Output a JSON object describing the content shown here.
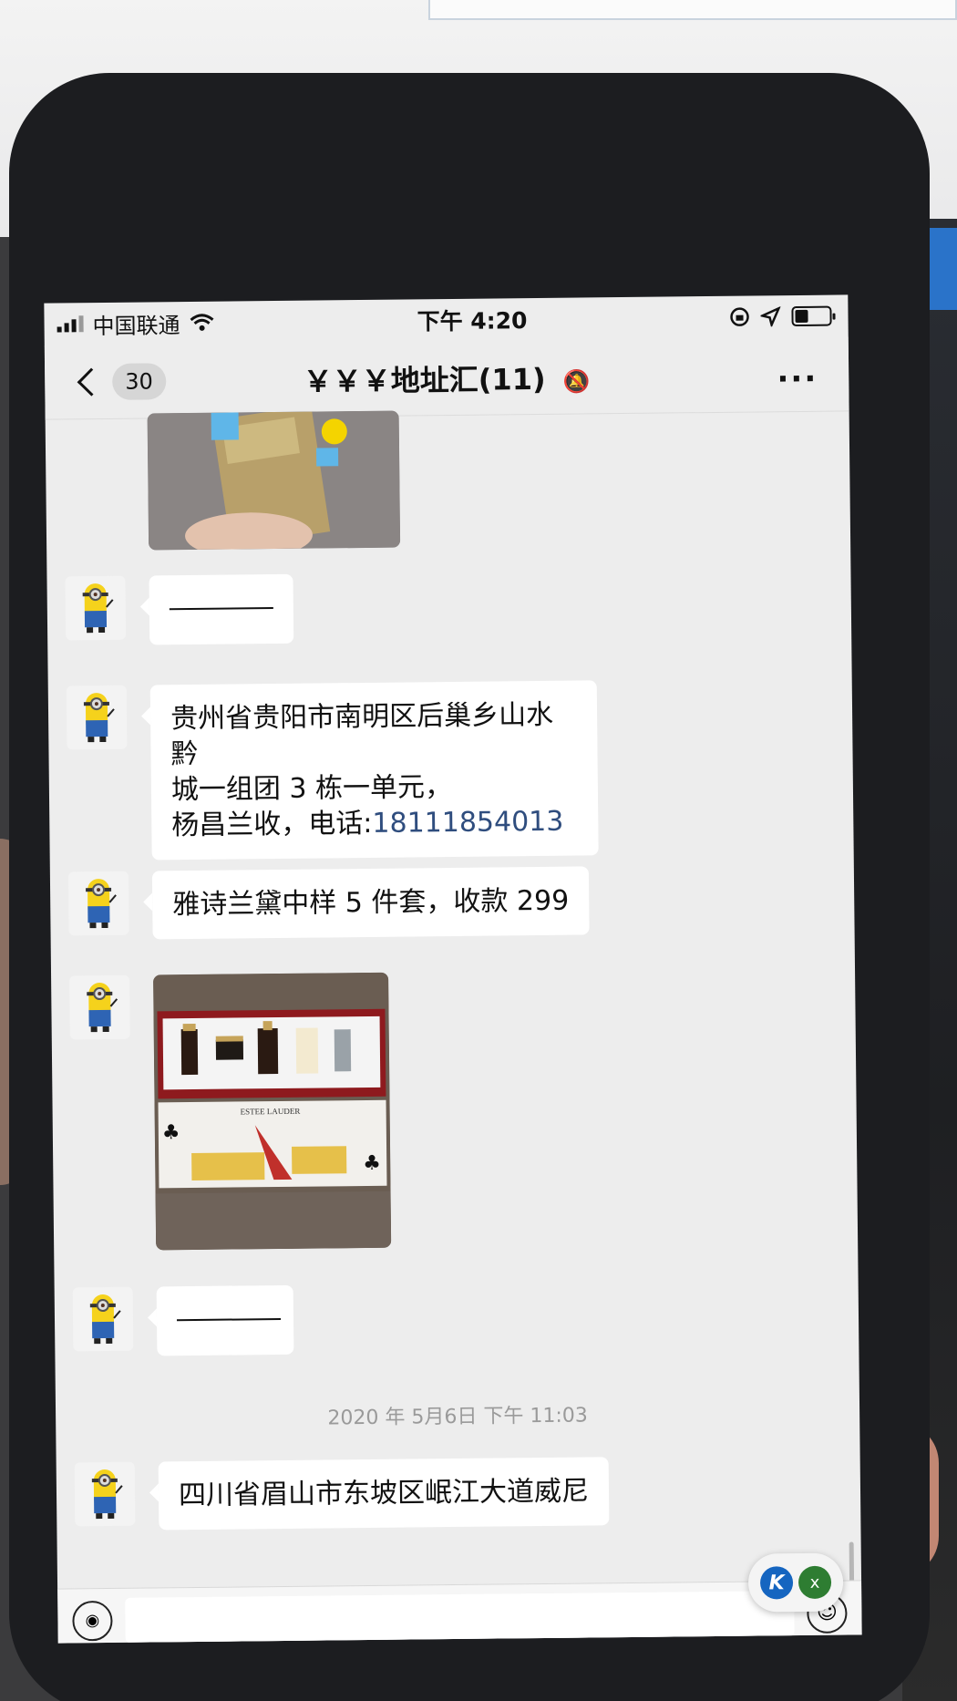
{
  "status_bar": {
    "carrier": "中国联通",
    "time": "下午 4:20"
  },
  "nav": {
    "unread_count": "30",
    "title": "￥￥￥地址汇(11)"
  },
  "messages": [
    {
      "type": "image",
      "description_icon": "sunscreen-photo"
    },
    {
      "type": "text",
      "dash": true
    },
    {
      "type": "text",
      "line1": "贵州省贵阳市南明区后巢乡山水黔",
      "line2": "城一组团 3 栋一单元，",
      "line3_prefix": "杨昌兰收，电话:",
      "phone": "18111854013"
    },
    {
      "type": "text",
      "text": "雅诗兰黛中样 5 件套，收款 299"
    },
    {
      "type": "image",
      "brand_text": "ESTEE LAUDER"
    },
    {
      "type": "text",
      "dash": true
    },
    {
      "type": "time",
      "text": "2020 年 5月6日  下午 11:03"
    },
    {
      "type": "text",
      "text": "四川省眉山市东坡区岷江大道威尼"
    }
  ],
  "input_bar": {
    "placeholder": ""
  },
  "widget": {
    "close_label": "x"
  },
  "colors": {
    "chat_bg": "#ededed",
    "bubble_bg": "#ffffff",
    "link": "#2f4d7e",
    "widget_blue": "#1565c0",
    "widget_green": "#2e7d32"
  }
}
